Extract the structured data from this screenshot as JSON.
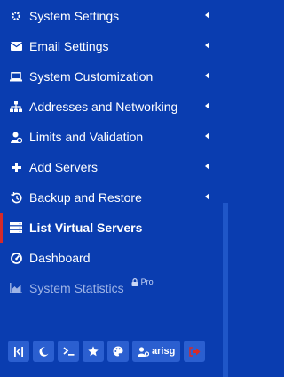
{
  "menu": [
    {
      "label": "System Settings",
      "icon": "gear-icon",
      "has_submenu": true
    },
    {
      "label": "Email Settings",
      "icon": "envelope-icon",
      "has_submenu": true
    },
    {
      "label": "System Customization",
      "icon": "laptop-icon",
      "has_submenu": true
    },
    {
      "label": "Addresses and Networking",
      "icon": "network-icon",
      "has_submenu": true
    },
    {
      "label": "Limits and Validation",
      "icon": "user-limits-icon",
      "has_submenu": true
    },
    {
      "label": "Add Servers",
      "icon": "plus-icon",
      "has_submenu": true
    },
    {
      "label": "Backup and Restore",
      "icon": "history-icon",
      "has_submenu": true
    },
    {
      "label": "List Virtual Servers",
      "icon": "server-list-icon",
      "active": true
    },
    {
      "label": "Dashboard",
      "icon": "dashboard-icon"
    },
    {
      "label": "System Statistics",
      "icon": "area-chart-icon",
      "disabled": true,
      "badge": "Pro"
    }
  ],
  "toolbar": {
    "user_label": "arisg",
    "buttons": [
      "collapse-icon",
      "moon-icon",
      "terminal-icon",
      "star-icon",
      "palette-icon",
      "user-cog-icon",
      "logout-icon"
    ]
  },
  "colors": {
    "background": "#0a3db0",
    "accent": "#d62a2a",
    "button": "#2b5fd0"
  }
}
